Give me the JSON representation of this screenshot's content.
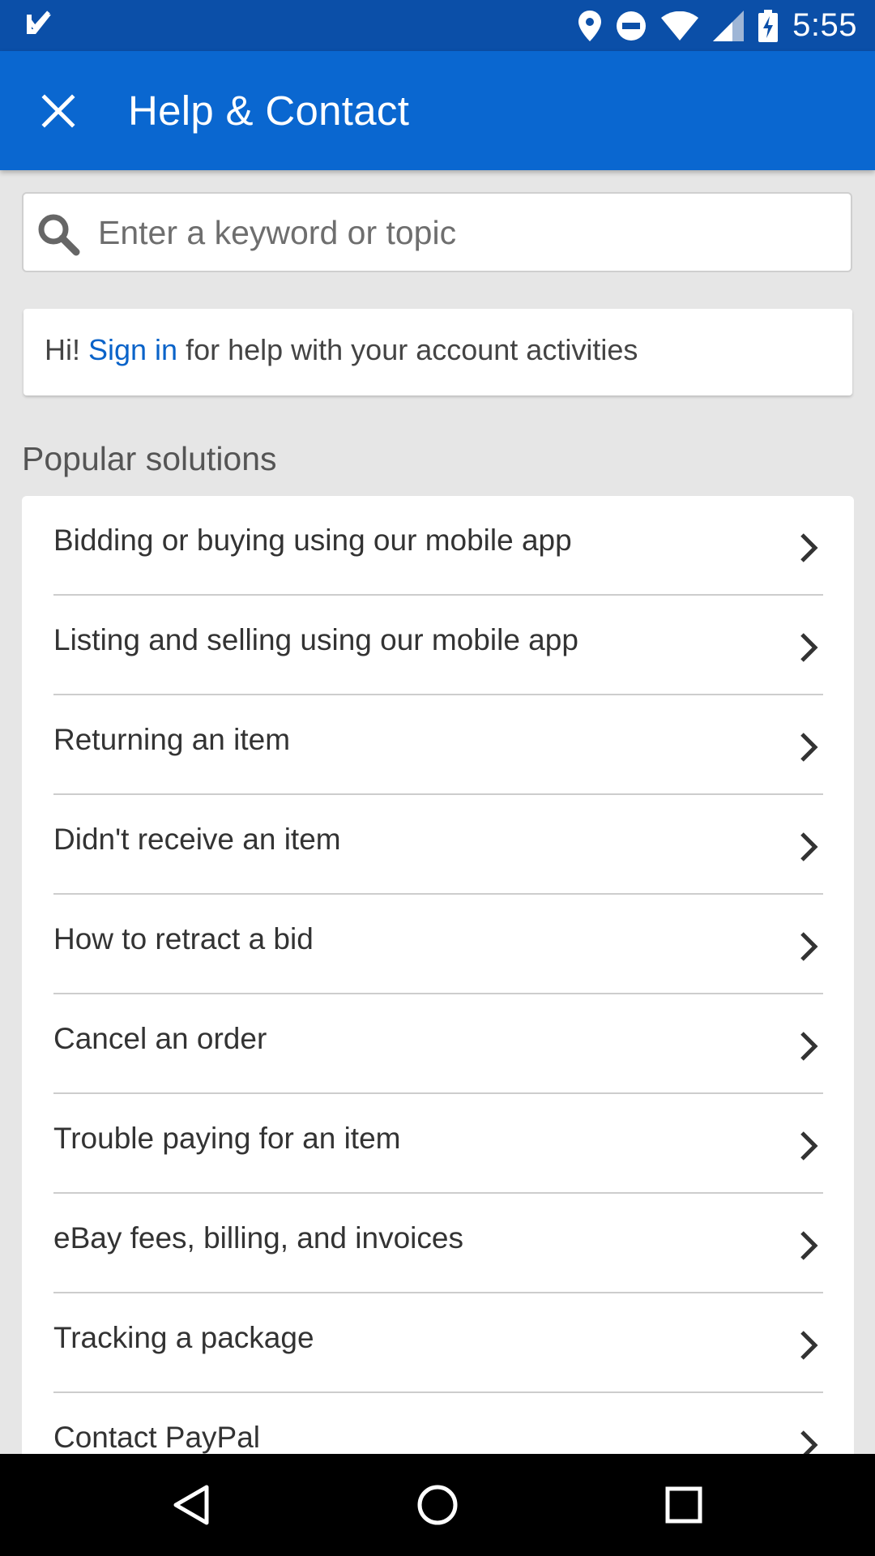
{
  "status_bar": {
    "time": "5:55",
    "icons": [
      "app-notification-icon",
      "location-icon",
      "do-not-disturb-icon",
      "wifi-icon",
      "cellular-signal-icon",
      "battery-charging-icon"
    ]
  },
  "app_bar": {
    "title": "Help & Contact",
    "close_icon": "close-icon"
  },
  "search": {
    "placeholder": "Enter a keyword or topic",
    "value": ""
  },
  "signin_card": {
    "prefix": "Hi! ",
    "link": "Sign in",
    "suffix": " for help with your account activities"
  },
  "popular": {
    "title": "Popular solutions",
    "items": [
      {
        "label": "Bidding or buying using our mobile app"
      },
      {
        "label": "Listing and selling using our mobile app"
      },
      {
        "label": "Returning an item"
      },
      {
        "label": "Didn't receive an item"
      },
      {
        "label": "How to retract a bid"
      },
      {
        "label": "Cancel an order"
      },
      {
        "label": "Trouble paying for an item"
      },
      {
        "label": "eBay fees, billing, and invoices"
      },
      {
        "label": "Tracking a package"
      },
      {
        "label": "Contact PayPal"
      }
    ]
  },
  "nav_bar": {
    "buttons": [
      "back-icon",
      "home-icon",
      "recents-icon"
    ]
  },
  "colors": {
    "status_bar": "#0b4fa8",
    "app_bar": "#0a67d0",
    "link": "#0a63c9",
    "background": "#e6e6e6"
  }
}
